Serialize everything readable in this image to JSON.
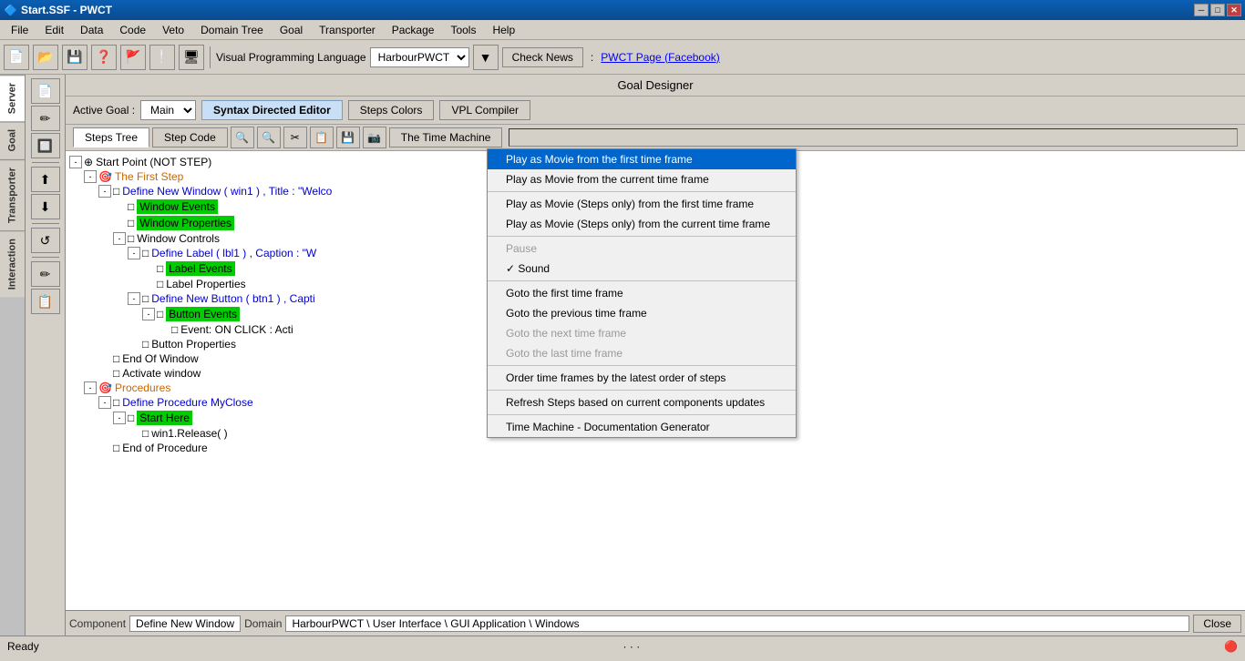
{
  "titleBar": {
    "title": "Start.SSF - PWCT",
    "controls": [
      "minimize",
      "maximize",
      "close"
    ]
  },
  "menuBar": {
    "items": [
      "File",
      "Edit",
      "Data",
      "Code",
      "Veto",
      "Domain Tree",
      "Goal",
      "Transporter",
      "Package",
      "Tools",
      "Help"
    ]
  },
  "toolbar": {
    "vplLabel": "Visual Programming Language",
    "vplValue": "HarbourPWCT",
    "checkNewsLabel": "Check News",
    "pwctLink": "PWCT Page (Facebook)"
  },
  "goalDesigner": {
    "header": "Goal Designer",
    "activeGoalLabel": "Active Goal :",
    "activeGoalValue": "Main",
    "tabs": [
      {
        "id": "syntax",
        "label": "Syntax Directed Editor",
        "active": true
      },
      {
        "id": "colors",
        "label": "Steps Colors",
        "active": false
      },
      {
        "id": "vpl",
        "label": "VPL Compiler",
        "active": false
      }
    ]
  },
  "stepsToolbar": {
    "tabs": [
      {
        "id": "tree",
        "label": "Steps Tree",
        "active": true
      },
      {
        "id": "code",
        "label": "Step Code",
        "active": false
      }
    ],
    "icons": [
      "🔍+",
      "🔍-",
      "✂",
      "📋",
      "💾",
      "📷"
    ],
    "timeMachineLabel": "The Time Machine"
  },
  "sidebarTabs": [
    {
      "id": "server",
      "label": "Server"
    },
    {
      "id": "goal",
      "label": "Goal"
    },
    {
      "id": "transporter",
      "label": "Transporter"
    },
    {
      "id": "interaction",
      "label": "Interaction"
    }
  ],
  "toolPanel": {
    "buttons": [
      "📄",
      "✏",
      "🔲",
      "⬆",
      "⬇",
      "↺",
      "✏",
      "📋"
    ]
  },
  "treeNodes": [
    {
      "level": 0,
      "type": "root",
      "icon": "⊕",
      "text": "Start Point (NOT STEP)",
      "color": "black",
      "expand": true
    },
    {
      "level": 1,
      "type": "step",
      "icon": "👤",
      "text": "The First Step",
      "color": "orange",
      "expand": false,
      "canExpand": true
    },
    {
      "level": 2,
      "type": "node",
      "text": "Define New Window  ( win1 ) , Title : \"Welco",
      "color": "blue",
      "expand": false,
      "canExpand": true
    },
    {
      "level": 3,
      "type": "leaf",
      "text": "Window Events",
      "color": "black",
      "highlight": "green"
    },
    {
      "level": 3,
      "type": "leaf",
      "text": "Window Properties",
      "color": "black",
      "highlight": "green"
    },
    {
      "level": 3,
      "type": "node",
      "text": "Window Controls",
      "color": "black",
      "expand": false,
      "canExpand": true
    },
    {
      "level": 4,
      "type": "node",
      "text": "Define Label ( lbl1 ) , Caption : \"W",
      "color": "blue",
      "expand": false,
      "canExpand": true
    },
    {
      "level": 5,
      "type": "leaf",
      "text": "Label Events",
      "color": "black",
      "highlight": "green"
    },
    {
      "level": 5,
      "type": "leaf",
      "text": "Label Properties",
      "color": "black"
    },
    {
      "level": 4,
      "type": "node",
      "text": "Define New Button ( btn1 ) , Capti",
      "color": "blue",
      "expand": false,
      "canExpand": true
    },
    {
      "level": 5,
      "type": "leaf",
      "text": "Button Events",
      "color": "black",
      "highlight": "green"
    },
    {
      "level": 6,
      "type": "leaf",
      "text": "Event: ON CLICK : Acti",
      "color": "black"
    },
    {
      "level": 5,
      "type": "leaf",
      "text": "Button Properties",
      "color": "black"
    },
    {
      "level": 3,
      "type": "leaf",
      "text": "End Of Window",
      "color": "black"
    },
    {
      "level": 3,
      "type": "leaf",
      "text": "Activate window",
      "color": "black"
    },
    {
      "level": 1,
      "type": "step",
      "icon": "👤",
      "text": "Procedures",
      "color": "orange",
      "expand": false,
      "canExpand": true
    },
    {
      "level": 2,
      "type": "node",
      "text": "Define Procedure MyClose",
      "color": "blue",
      "expand": false,
      "canExpand": true
    },
    {
      "level": 3,
      "type": "leaf",
      "text": "Start Here",
      "color": "black",
      "highlight": "green"
    },
    {
      "level": 4,
      "type": "leaf",
      "text": "win1.Release( )",
      "color": "black"
    },
    {
      "level": 3,
      "type": "leaf",
      "text": "End of Procedure",
      "color": "black"
    }
  ],
  "timeMachineMenu": {
    "items": [
      {
        "id": "play-first",
        "label": "Play as Movie from the first time frame",
        "highlighted": true
      },
      {
        "id": "play-current",
        "label": "Play as Movie from the current time frame",
        "disabled": false
      },
      {
        "id": "separator1",
        "type": "separator"
      },
      {
        "id": "play-steps-first",
        "label": "Play as Movie (Steps only) from the first time frame"
      },
      {
        "id": "play-steps-current",
        "label": "Play as Movie (Steps only) from the current time frame",
        "disabled": false
      },
      {
        "id": "separator2",
        "type": "separator"
      },
      {
        "id": "pause",
        "label": "Pause",
        "disabled": true
      },
      {
        "id": "sound",
        "label": "Sound",
        "checked": true
      },
      {
        "id": "separator3",
        "type": "separator"
      },
      {
        "id": "goto-first",
        "label": "Goto the first time frame"
      },
      {
        "id": "goto-prev",
        "label": "Goto the previous time frame"
      },
      {
        "id": "goto-next",
        "label": "Goto the next time frame",
        "disabled": true
      },
      {
        "id": "goto-last",
        "label": "Goto the last time frame",
        "disabled": true
      },
      {
        "id": "separator4",
        "type": "separator"
      },
      {
        "id": "order-frames",
        "label": "Order time frames by the latest order of steps"
      },
      {
        "id": "separator5",
        "type": "separator"
      },
      {
        "id": "refresh",
        "label": "Refresh Steps based on current components updates"
      },
      {
        "id": "separator6",
        "type": "separator"
      },
      {
        "id": "doc-gen",
        "label": "Time Machine - Documentation Generator"
      }
    ]
  },
  "statusBar": {
    "componentLabel": "Component",
    "componentValue": "Define New Window",
    "domainLabel": "Domain",
    "domainValue": "HarbourPWCT \\ User Interface \\ GUI Application \\ Windows",
    "closeLabel": "Close"
  },
  "readyBar": {
    "status": "Ready"
  }
}
